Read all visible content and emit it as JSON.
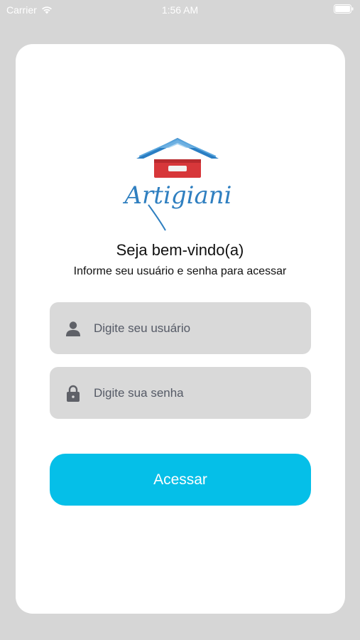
{
  "status_bar": {
    "carrier": "Carrier",
    "time": "1:56 AM",
    "icons": [
      "wifi-icon",
      "battery-icon"
    ]
  },
  "logo": {
    "brand_text": "Artigiani",
    "colors": {
      "roof": "#2a7ec3",
      "body": "#d7373a",
      "script": "#2f7fc0"
    }
  },
  "login": {
    "title": "Seja bem-vindo(a)",
    "subtitle": "Informe seu usuário e senha para acessar",
    "username": {
      "placeholder": "Digite seu usuário",
      "value": "",
      "icon": "user-icon"
    },
    "password": {
      "placeholder": "Digite sua senha",
      "value": "",
      "icon": "lock-icon"
    },
    "submit_label": "Acessar"
  },
  "colors": {
    "background": "#d6d6d6",
    "card": "#ffffff",
    "field": "#d9d9d9",
    "accent": "#05bfe8"
  }
}
